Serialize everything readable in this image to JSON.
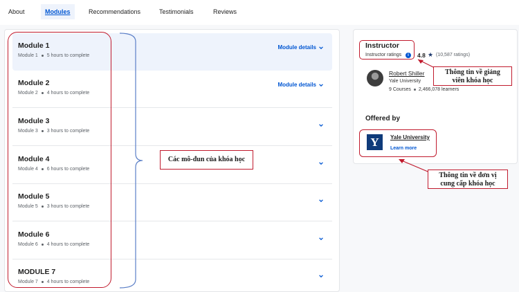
{
  "tabs": [
    {
      "label": "About",
      "active": false
    },
    {
      "label": "Modules",
      "active": true
    },
    {
      "label": "Recommendations",
      "active": false
    },
    {
      "label": "Testimonials",
      "active": false
    },
    {
      "label": "Reviews",
      "active": false
    }
  ],
  "modules": [
    {
      "title": "Module 1",
      "number": "Module 1",
      "duration": "5 hours to complete",
      "details_label": "Module details"
    },
    {
      "title": "Module 2",
      "number": "Module 2",
      "duration": "4 hours to complete",
      "details_label": "Module details"
    },
    {
      "title": "Module 3",
      "number": "Module 3",
      "duration": "3 hours to complete"
    },
    {
      "title": "Module 4",
      "number": "Module 4",
      "duration": "6 hours to complete"
    },
    {
      "title": "Module 5",
      "number": "Module 5",
      "duration": "3 hours to complete"
    },
    {
      "title": "Module 6",
      "number": "Module 6",
      "duration": "4 hours to complete"
    },
    {
      "title": "MODULE 7",
      "number": "Module 7",
      "duration": "4 hours to complete"
    }
  ],
  "instructor": {
    "heading": "Instructor",
    "ratings_label": "Instructor ratings",
    "info_glyph": "i",
    "rating": "4.8",
    "star": "★",
    "rating_count": "(10,587 ratings)",
    "name": "Robert Shiller",
    "org": "Yale University",
    "courses": "9 Courses",
    "learners": "2,466,078 learners"
  },
  "offered_by": {
    "heading": "Offered by",
    "logo_letter": "Y",
    "name": "Yale University",
    "learn_more": "Learn more"
  },
  "annotations": {
    "modules_note": "Các mô-đun của khóa học",
    "instructor_note_line1": "Thông tin về giảng",
    "instructor_note_line2": "viên khóa học",
    "provider_note_line1": "Thông tin về đơn vị",
    "provider_note_line2": "cung cấp khóa học"
  },
  "colors": {
    "accent": "#0056d2",
    "annotation": "#c0192c",
    "bracket": "#5b7fc7"
  }
}
